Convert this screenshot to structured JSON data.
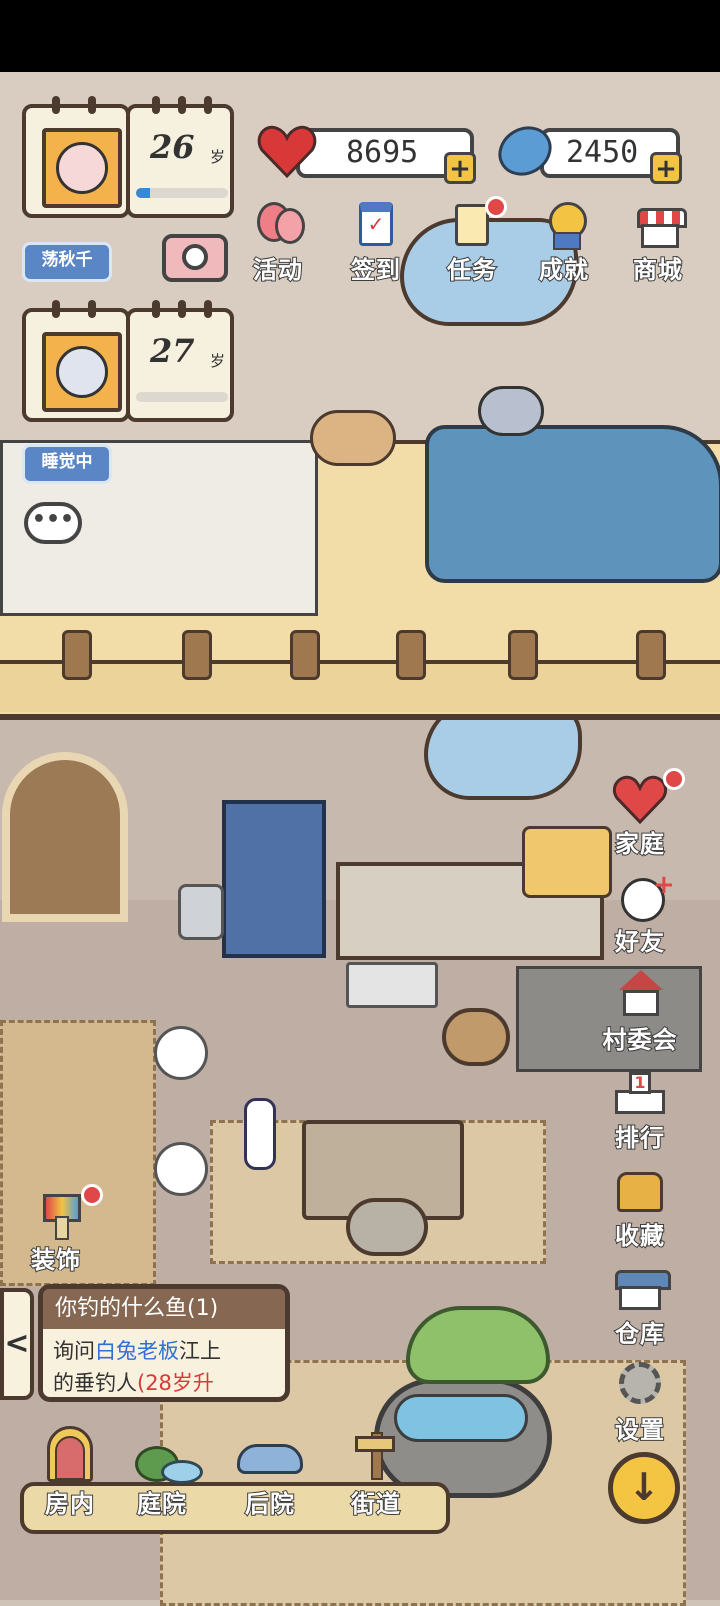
{
  "characters": [
    {
      "age": "26",
      "age_unit": "岁",
      "age_progress": 0.15,
      "name": "荡秋千"
    },
    {
      "age": "27",
      "age_unit": "岁",
      "age_progress": 0.0,
      "name": "睡觉中"
    }
  ],
  "currency": {
    "hearts": "8695",
    "gems": "2450",
    "plus": "+"
  },
  "top_menu": [
    {
      "label": "活动",
      "icon": "balloon-icon"
    },
    {
      "label": "签到",
      "icon": "checkin-icon"
    },
    {
      "label": "任务",
      "icon": "task-scroll-icon"
    },
    {
      "label": "成就",
      "icon": "medal-icon"
    },
    {
      "label": "商城",
      "icon": "shop-icon"
    }
  ],
  "side_menu": [
    {
      "label": "家庭",
      "icon": "heart-icon"
    },
    {
      "label": "好友",
      "icon": "panda-icon"
    },
    {
      "label": "村委会",
      "icon": "village-house-icon"
    },
    {
      "label": "排行",
      "icon": "podium-icon",
      "badge": "1"
    },
    {
      "label": "收藏",
      "icon": "treasure-chest-icon"
    },
    {
      "label": "仓库",
      "icon": "warehouse-icon"
    },
    {
      "label": "设置",
      "icon": "gear-icon"
    }
  ],
  "decorate": {
    "label": "装饰",
    "icon": "paint-brush-icon"
  },
  "quest": {
    "title": "你钓的什么鱼(1)",
    "line1_a": "询问",
    "line1_b": "白兔老板",
    "line1_c": "江上",
    "line2_a": "的垂钓人",
    "line2_b": "(28岁升",
    "collapse": "<"
  },
  "bottom_nav": [
    {
      "label": "房内",
      "icon": "indoor-door-icon"
    },
    {
      "label": "庭院",
      "icon": "courtyard-icon"
    },
    {
      "label": "后院",
      "icon": "car-icon"
    },
    {
      "label": "街道",
      "icon": "signpost-icon"
    }
  ],
  "chat": "•••",
  "down_arrow": "↓",
  "colors": {
    "accent": "#f3c343",
    "badge": "#e04848",
    "link": "#2f6fd6",
    "alert": "#d83a3a"
  }
}
